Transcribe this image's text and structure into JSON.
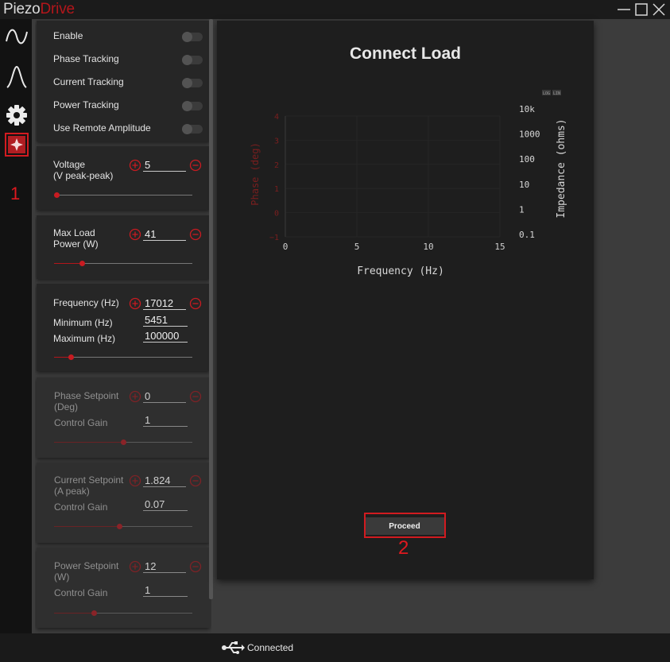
{
  "app": {
    "logo_part1": "Piezo",
    "logo_part2": "Drive"
  },
  "window_controls": [
    "minimize-icon",
    "maximize-icon",
    "close-icon"
  ],
  "rail": {
    "items": [
      {
        "name": "waveform-icon"
      },
      {
        "name": "peak-icon"
      },
      {
        "name": "gear-icon"
      },
      {
        "name": "diamond-icon",
        "selected": true
      }
    ],
    "annotation": "1"
  },
  "toggles": [
    {
      "label": "Enable",
      "on": false
    },
    {
      "label": "Phase Tracking",
      "on": false
    },
    {
      "label": "Current Tracking",
      "on": false
    },
    {
      "label": "Power Tracking",
      "on": false
    },
    {
      "label": "Use Remote Amplitude",
      "on": false
    }
  ],
  "voltage": {
    "label_line1": "Voltage",
    "label_line2": "(V peak-peak)",
    "value": "5",
    "slider_level": 0.02
  },
  "max_load": {
    "label_line1": "Max Load",
    "label_line2": "Power (W)",
    "value": "41",
    "slider_level": 0.2
  },
  "frequency": {
    "label": "Frequency (Hz)",
    "value": "17012",
    "min_label": "Minimum (Hz)",
    "min_value": "5451",
    "max_label": "Maximum (Hz)",
    "max_value": "100000",
    "slider_level": 0.12
  },
  "phase_setpoint": {
    "label_line1": "Phase Setpoint",
    "label_line2": "(Deg)",
    "value": "0",
    "gain_label": "Control Gain",
    "gain_value": "1",
    "slider_level": 0.5
  },
  "current_setpoint": {
    "label_line1": "Current Setpoint",
    "label_line2": "(A peak)",
    "value": "1.824",
    "gain_label": "Control Gain",
    "gain_value": "0.07",
    "slider_level": 0.47
  },
  "power_setpoint": {
    "label_line1": "Power Setpoint",
    "label_line2": "(W)",
    "value": "12",
    "gain_label": "Control Gain",
    "gain_value": "1",
    "slider_level": 0.29
  },
  "main": {
    "title": "Connect Load",
    "proceed_label": "Proceed",
    "annotation": "2"
  },
  "status": {
    "text": "Connected",
    "icon": "usb-icon"
  },
  "colors": {
    "accent": "#b3161b",
    "highlight": "#d21b20",
    "phase_axis": "#7a1e1e"
  },
  "chart_data": {
    "type": "line",
    "title": "",
    "xlabel": "Frequency (Hz)",
    "ylabel": "Phase (deg)",
    "y2label": "Impedance (ohms)",
    "xlim": [
      0,
      15
    ],
    "ylim": [
      -1,
      4
    ],
    "x_ticks": [
      "0",
      "5",
      "10",
      "15"
    ],
    "y_ticks": [
      "−1",
      "0",
      "1",
      "2",
      "3",
      "4"
    ],
    "y2_ticks": [
      "0.1",
      "1",
      "10",
      "100",
      "1000",
      "10k"
    ],
    "y2_scale": "log",
    "corner_labels": [
      "LOG",
      "LIN"
    ],
    "series": []
  }
}
